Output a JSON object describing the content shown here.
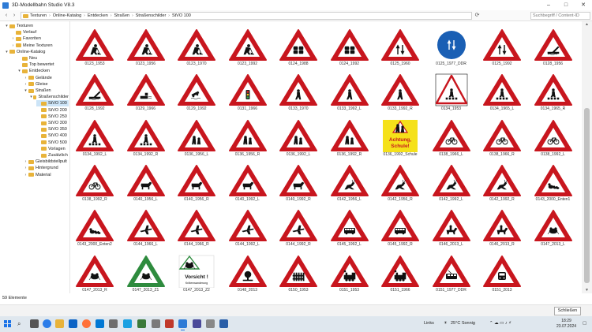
{
  "window": {
    "title": "3D-Modellbahn Studio V8.3",
    "controls": [
      "–",
      "□",
      "✕"
    ]
  },
  "toolbar": {
    "breadcrumb": [
      "Texturen",
      "Online-Katalog",
      "Entdecken",
      "Straßen",
      "Straßenschilder",
      "StVO 100"
    ],
    "search_placeholder": "Suchbegriff / Content-ID"
  },
  "sidebar": {
    "items": [
      {
        "label": "Texturen",
        "exp": "▾"
      },
      {
        "label": "Verlauf",
        "exp": ""
      },
      {
        "label": "Favoriten",
        "exp": "›"
      },
      {
        "label": "Meine Texturen",
        "exp": "›"
      },
      {
        "label": "Online-Katalog",
        "exp": "▾"
      },
      {
        "label": "Neu",
        "exp": ""
      },
      {
        "label": "Top bewertet",
        "exp": ""
      },
      {
        "label": "Entdecken",
        "exp": "▾"
      },
      {
        "label": "Gelände",
        "exp": "›"
      },
      {
        "label": "Gleise",
        "exp": "›"
      },
      {
        "label": "Straßen",
        "exp": "▾"
      },
      {
        "label": "Straßenschilder",
        "exp": "▾"
      },
      {
        "label": "StVO 100",
        "exp": ""
      },
      {
        "label": "StVO 200",
        "exp": ""
      },
      {
        "label": "StVO 250",
        "exp": ""
      },
      {
        "label": "StVO 300",
        "exp": ""
      },
      {
        "label": "StVO 350",
        "exp": ""
      },
      {
        "label": "StVO 400",
        "exp": ""
      },
      {
        "label": "StVO 500",
        "exp": ""
      },
      {
        "label": "Vorlagen",
        "exp": ""
      },
      {
        "label": "Zusätzlich",
        "exp": ""
      },
      {
        "label": "Gleisbildstellpult",
        "exp": "›"
      },
      {
        "label": "Hintergrund",
        "exp": "›"
      },
      {
        "label": "Material",
        "exp": "›"
      }
    ],
    "selected_label": "StVO 100"
  },
  "grid": {
    "tiles": [
      {
        "label": "0123_1953",
        "kind": "tri",
        "icon": "worker-icon"
      },
      {
        "label": "0123_1956",
        "kind": "tri",
        "icon": "worker-icon"
      },
      {
        "label": "0123_1970",
        "kind": "tri",
        "icon": "worker-icon"
      },
      {
        "label": "0123_1992",
        "kind": "tri",
        "icon": "worker-icon"
      },
      {
        "label": "0124_1988",
        "kind": "tri",
        "icon": "traffic-jam-icon"
      },
      {
        "label": "0124_1992",
        "kind": "tri",
        "icon": "traffic-jam-icon"
      },
      {
        "label": "0125_1960",
        "kind": "tri",
        "icon": "two-way-arrows-icon"
      },
      {
        "label": "0125_1977_DDR",
        "kind": "circle",
        "icon": "two-way-arrows-icon"
      },
      {
        "label": "0125_1992",
        "kind": "tri",
        "icon": "two-way-arrows-icon"
      },
      {
        "label": "0128_1956",
        "kind": "tri",
        "icon": "bridge-icon"
      },
      {
        "label": "0128_1992",
        "kind": "tri",
        "icon": "bridge-icon"
      },
      {
        "label": "0129_1966",
        "kind": "tri",
        "icon": "quay-icon"
      },
      {
        "label": "0129_1992",
        "kind": "tri",
        "icon": "car-water-icon"
      },
      {
        "label": "0131_1966",
        "kind": "tri",
        "icon": "traffic-light-icon"
      },
      {
        "label": "0133_1970",
        "kind": "tri",
        "icon": "pedestrian-icon"
      },
      {
        "label": "0133_1992_L",
        "kind": "tri",
        "icon": "pedestrian-icon"
      },
      {
        "label": "0133_1992_R",
        "kind": "tri",
        "icon": "pedestrian-icon"
      },
      {
        "label": "0134_1953",
        "kind": "square",
        "icon": "crosswalk-icon"
      },
      {
        "label": "0134_1965_L",
        "kind": "tri",
        "icon": "crosswalk-icon"
      },
      {
        "label": "0134_1965_R",
        "kind": "tri",
        "icon": "crosswalk-icon"
      },
      {
        "label": "0134_1992_L",
        "kind": "tri",
        "icon": "crosswalk-icon"
      },
      {
        "label": "0134_1992_R",
        "kind": "tri",
        "icon": "crosswalk-icon"
      },
      {
        "label": "0136_1956_L",
        "kind": "tri",
        "icon": "children-icon"
      },
      {
        "label": "0136_1956_R",
        "kind": "tri",
        "icon": "children-icon"
      },
      {
        "label": "0136_1992_L",
        "kind": "tri",
        "icon": "children-icon"
      },
      {
        "label": "0136_1992_R",
        "kind": "tri",
        "icon": "children-icon"
      },
      {
        "label": "0136_1992_Schule",
        "kind": "school",
        "icon": "children-icon",
        "text1": "Achtung,",
        "text2": "Schule!"
      },
      {
        "label": "0138_1966_L",
        "kind": "tri",
        "icon": "bicycle-icon"
      },
      {
        "label": "0138_1966_R",
        "kind": "tri",
        "icon": "bicycle-icon"
      },
      {
        "label": "0138_1992_L",
        "kind": "tri",
        "icon": "bicycle-icon"
      },
      {
        "label": "0138_1992_R",
        "kind": "tri",
        "icon": "bicycle-icon"
      },
      {
        "label": "0140_1956_L",
        "kind": "tri",
        "icon": "cow-icon"
      },
      {
        "label": "0140_1956_R",
        "kind": "tri",
        "icon": "cow-icon"
      },
      {
        "label": "0140_1992_L",
        "kind": "tri",
        "icon": "cow-icon"
      },
      {
        "label": "0140_1992_R",
        "kind": "tri",
        "icon": "cow-icon"
      },
      {
        "label": "0142_1956_L",
        "kind": "tri",
        "icon": "deer-icon"
      },
      {
        "label": "0142_1956_R",
        "kind": "tri",
        "icon": "deer-icon"
      },
      {
        "label": "0142_1992_L",
        "kind": "tri",
        "icon": "deer-icon"
      },
      {
        "label": "0142_1992_R",
        "kind": "tri",
        "icon": "deer-icon"
      },
      {
        "label": "0143_2000_Enten1",
        "kind": "tri",
        "icon": "ducks-icon"
      },
      {
        "label": "0143_2000_Enten2",
        "kind": "tri",
        "icon": "ducks-icon"
      },
      {
        "label": "0144_1966_L",
        "kind": "tri",
        "icon": "airplane-icon"
      },
      {
        "label": "0144_1966_R",
        "kind": "tri",
        "icon": "airplane-icon"
      },
      {
        "label": "0144_1992_L",
        "kind": "tri",
        "icon": "airplane-icon"
      },
      {
        "label": "0144_1992_R",
        "kind": "tri",
        "icon": "airplane-icon"
      },
      {
        "label": "0145_1992_L",
        "kind": "tri",
        "icon": "bus-icon"
      },
      {
        "label": "0145_1992_R",
        "kind": "tri",
        "icon": "bus-icon"
      },
      {
        "label": "0146_2013_L",
        "kind": "tri",
        "icon": "rider-icon"
      },
      {
        "label": "0146_2013_R",
        "kind": "tri",
        "icon": "rider-icon"
      },
      {
        "label": "0147_2013_L",
        "kind": "tri",
        "icon": "frog-icon"
      },
      {
        "label": "0147_2013_R",
        "kind": "tri",
        "icon": "frog-icon"
      },
      {
        "label": "0147_2013_Z1",
        "kind": "greentri",
        "icon": "frog-icon"
      },
      {
        "label": "0147_2013_Z2",
        "kind": "vorsicht",
        "icon": "frog-icon",
        "text1": "Vorsicht !",
        "text2": "Krötenwanderung"
      },
      {
        "label": "0148_2013",
        "kind": "tri",
        "icon": "tree-fall-icon"
      },
      {
        "label": "0150_1953",
        "kind": "tri",
        "icon": "gate-icon"
      },
      {
        "label": "0151_1953",
        "kind": "tri",
        "icon": "steam-train-icon"
      },
      {
        "label": "0151_1966",
        "kind": "tri",
        "icon": "steam-train-icon"
      },
      {
        "label": "0151_1977_DDR",
        "kind": "tri",
        "icon": "tram-icon"
      },
      {
        "label": "0151_2013",
        "kind": "tri",
        "icon": "train-icon"
      }
    ]
  },
  "status": {
    "count_text": "59 Elemente"
  },
  "footer": {
    "close_label": "Schließen"
  },
  "taskbar": {
    "weather": "25°C  Sonnig",
    "links_label": "Links",
    "time": "18:29",
    "date": "23.07.2024"
  },
  "colors": {
    "sign_red": "#c8161e",
    "school_yellow": "#f5e11a",
    "blue": "#1a5fb4",
    "green": "#2e8b3e",
    "selection": "#cce4f7"
  }
}
